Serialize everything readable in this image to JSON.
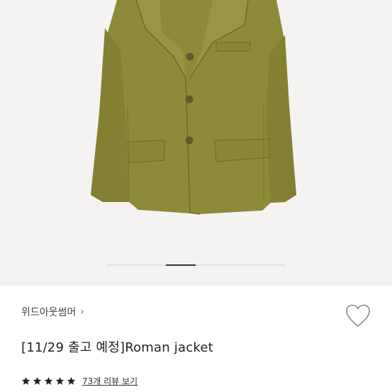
{
  "gallery": {
    "image_alt": "Roman jacket",
    "image_count": 6,
    "active_index": 2
  },
  "brand": {
    "name": "위드아웃썸머",
    "chevron": "›"
  },
  "product": {
    "title": "[11/29 출고 예정]Roman jacket"
  },
  "rating": {
    "stars": 5,
    "review_link": "73개 리뷰 보기"
  },
  "icons": {
    "like": "heart-outline-icon",
    "star": "star-icon",
    "brand_arrow": "chevron-right-icon"
  },
  "colors": {
    "jacket": "#8e8a3a",
    "star": "#222222",
    "heart_stroke": "#8a8a8a"
  }
}
